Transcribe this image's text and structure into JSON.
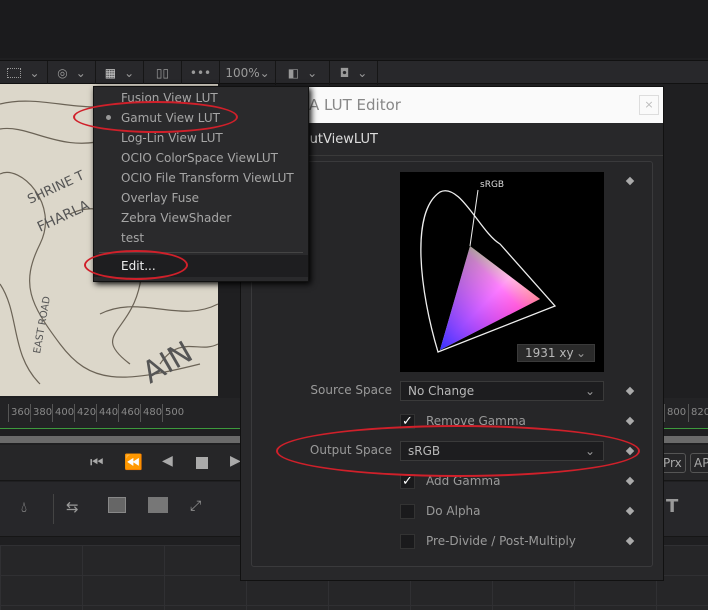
{
  "toolbar": {
    "zoom": "100%"
  },
  "menu": {
    "items": [
      {
        "label": "Fusion View LUT",
        "selected": false
      },
      {
        "label": "Gamut View LUT",
        "selected": true
      },
      {
        "label": "Log-Lin View LUT",
        "selected": false
      },
      {
        "label": "OCIO ColorSpace ViewLUT",
        "selected": false
      },
      {
        "label": "OCIO File Transform ViewLUT",
        "selected": false
      },
      {
        "label": "Overlay Fuse",
        "selected": false
      },
      {
        "label": "Zebra ViewShader",
        "selected": false
      },
      {
        "label": "test",
        "selected": false
      }
    ],
    "edit": "Edit..."
  },
  "dialog": {
    "title": "A LUT Editor",
    "close": "×",
    "subtitle": "mutViewLUT",
    "plot": {
      "label": "sRGB",
      "mode": "1931 xy"
    },
    "source_space": {
      "label": "Source Space",
      "value": "No Change"
    },
    "remove_gamma": {
      "label": "Remove Gamma",
      "checked": true
    },
    "output_space": {
      "label": "Output Space",
      "value": "sRGB"
    },
    "add_gamma": {
      "label": "Add Gamma",
      "checked": true
    },
    "do_alpha": {
      "label": "Do Alpha",
      "checked": false
    },
    "predivide": {
      "label": "Pre-Divide / Post-Multiply",
      "checked": false
    }
  },
  "ruler": {
    "ticks": [
      "360",
      "380",
      "400",
      "420",
      "440",
      "460",
      "480",
      "500"
    ],
    "right_ticks": [
      "800",
      "820"
    ]
  },
  "transport": {
    "prx": "Prx",
    "ap": "AP"
  },
  "colors": {
    "highlight": "#d0202a",
    "background": "#28282a"
  }
}
